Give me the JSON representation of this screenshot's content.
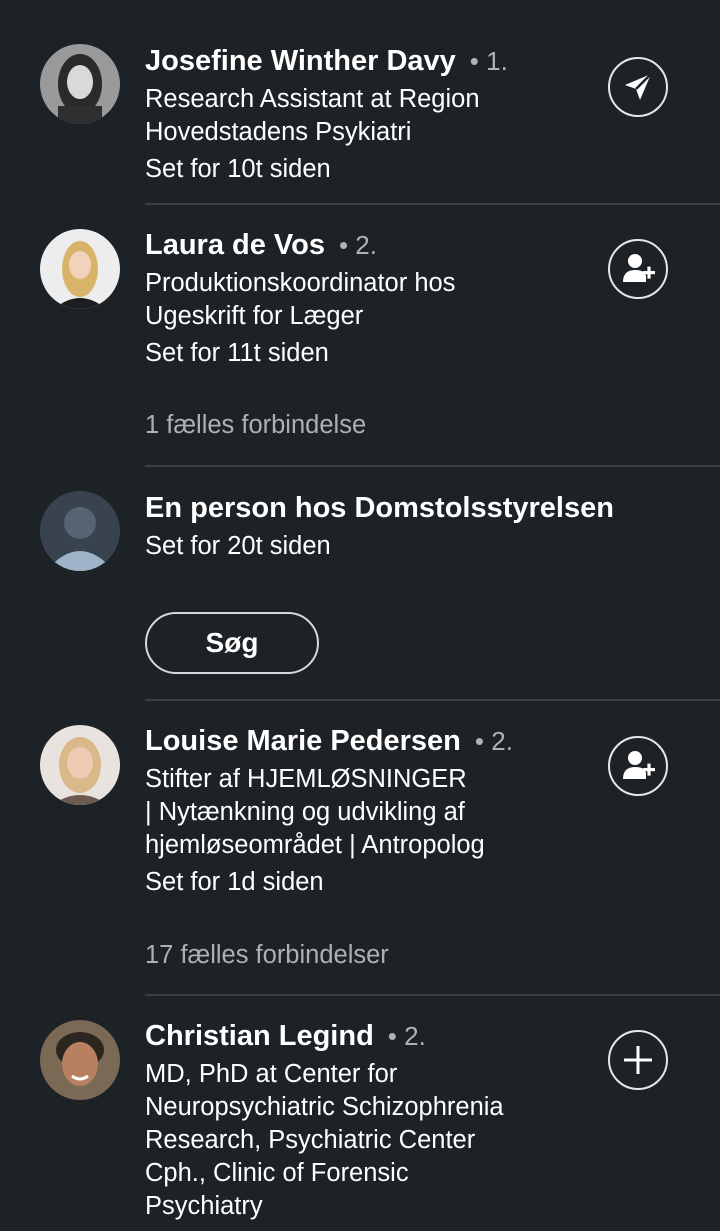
{
  "viewers": [
    {
      "name": "Josefine Winther Davy",
      "degree": "• 1.",
      "headline_lines": [
        "Research Assistant at Region",
        "Hovedstadens Psykiatri"
      ],
      "seen": "Set for 10t siden",
      "action_icon": "send-message-icon"
    },
    {
      "name": "Laura de Vos",
      "degree": "• 2.",
      "headline_lines": [
        "Produktionskoordinator hos",
        "Ugeskrift for Læger"
      ],
      "seen": "Set for 11t siden",
      "mutual": "1 fælles forbindelse",
      "action_icon": "add-connection-icon"
    },
    {
      "name": "En person hos Domstolsstyrelsen",
      "seen": "Set for 20t siden",
      "button": "Søg"
    },
    {
      "name": "Louise Marie Pedersen",
      "degree": "• 2.",
      "headline_lines": [
        "Stifter af HJEMLØSNINGER",
        "| Nytænkning og udvikling af",
        "hjemløseområdet | Antropolog"
      ],
      "seen": "Set for 1d siden",
      "mutual": "17 fælles forbindelser",
      "action_icon": "add-connection-icon"
    },
    {
      "name": "Christian Legind",
      "degree": "• 2.",
      "headline_lines": [
        "MD, PhD at Center for",
        "Neuropsychiatric Schizophrenia",
        "Research, Psychiatric Center",
        "Cph., Clinic of Forensic",
        "Psychiatry"
      ],
      "action_icon": "follow-plus-icon"
    }
  ],
  "colors": {
    "background": "#1d2226",
    "text": "#ffffff",
    "secondary_text": "#aeb1b4",
    "divider": "#3a3f43"
  }
}
